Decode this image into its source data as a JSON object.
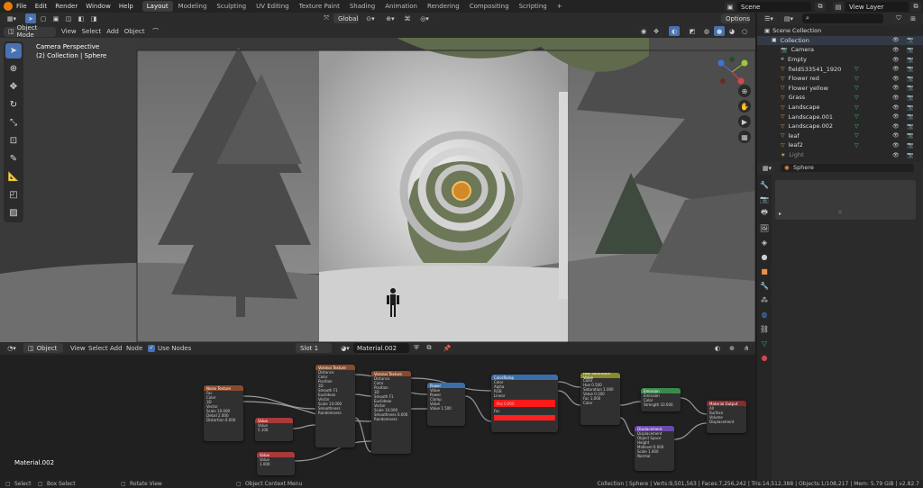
{
  "topbar": {
    "menus": [
      "File",
      "Edit",
      "Render",
      "Window",
      "Help"
    ],
    "workspaces": [
      "Layout",
      "Modeling",
      "Sculpting",
      "UV Editing",
      "Texture Paint",
      "Shading",
      "Animation",
      "Rendering",
      "Compositing",
      "Scripting"
    ],
    "active_workspace": "Layout",
    "add_tab": "+",
    "scene_label": "Scene",
    "view_layer_label": "View Layer"
  },
  "header2": {
    "transform_orientation": "Global",
    "options": "Options"
  },
  "viewport": {
    "mode": "Object Mode",
    "menus": [
      "View",
      "Select",
      "Add",
      "Object"
    ],
    "overlay_title": "Camera Perspective",
    "overlay_subtitle": "(2) Collection | Sphere"
  },
  "outliner": {
    "search_placeholder": "",
    "scene_collection": "Scene Collection",
    "items": [
      {
        "name": "Collection",
        "kind": "collection"
      },
      {
        "name": "Camera",
        "kind": "camera"
      },
      {
        "name": "Empty",
        "kind": "empty"
      },
      {
        "name": "field533541_1920",
        "kind": "mesh"
      },
      {
        "name": "Flower red",
        "kind": "mesh"
      },
      {
        "name": "Flower yellow",
        "kind": "mesh"
      },
      {
        "name": "Grass",
        "kind": "mesh"
      },
      {
        "name": "Landscape",
        "kind": "mesh"
      },
      {
        "name": "Landscape.001",
        "kind": "mesh"
      },
      {
        "name": "Landscape.002",
        "kind": "mesh"
      },
      {
        "name": "leaf",
        "kind": "mesh"
      },
      {
        "name": "leaf2",
        "kind": "mesh"
      },
      {
        "name": "Light",
        "kind": "light"
      }
    ]
  },
  "properties": {
    "object_name": "Sphere",
    "value_placeholder": "::"
  },
  "node_editor": {
    "editor_type": "Object",
    "menus": [
      "View",
      "Select",
      "Add",
      "Node"
    ],
    "use_nodes_label": "Use Nodes",
    "slot": "Slot 1",
    "material": "Material.002",
    "material_label": "Material.002"
  },
  "nodes": [
    {
      "id": "noise",
      "title": "Noise Texture",
      "rows": [
        "Fac",
        "Color",
        "3D",
        "Vector",
        "Scale 10.000",
        "Detail 2.000",
        "Distortion 0.000"
      ]
    },
    {
      "id": "voronoi1",
      "title": "Voronoi Texture",
      "rows": [
        "Distance",
        "Color",
        "Position",
        "3D",
        "Smooth F1",
        "Euclidean",
        "Vector",
        "Scale 10.000",
        "Smoothness",
        "Randomness"
      ]
    },
    {
      "id": "voronoi2",
      "title": "Voronoi Texture",
      "rows": [
        "Distance",
        "Color",
        "Position",
        "3D",
        "Smooth F1",
        "Euclidean",
        "Vector",
        "Scale 10.000",
        "Smoothness 0.000",
        "Randomness"
      ]
    },
    {
      "id": "value1",
      "title": "Value",
      "rows": [
        "Value",
        "5.100"
      ]
    },
    {
      "id": "value2",
      "title": "Value",
      "rows": [
        "Value",
        "1.000"
      ]
    },
    {
      "id": "power",
      "title": "Power",
      "rows": [
        "Value",
        "Power",
        "Clamp",
        "Value",
        "Value 1.500"
      ]
    },
    {
      "id": "colorramp",
      "title": "ColorRamp",
      "rows": [
        "Color",
        "Alpha",
        "RGB",
        "Linear",
        "Pos 0.000",
        "Fac"
      ]
    },
    {
      "id": "principled",
      "title": "Hue Saturation Value",
      "rows": [
        "Color",
        "Hue 0.500",
        "Saturation 1.000",
        "Value 0.100",
        "Fac 1.000",
        "Color"
      ]
    },
    {
      "id": "emission",
      "title": "Emission",
      "rows": [
        "Emission",
        "Color",
        "Strength 10.000"
      ]
    },
    {
      "id": "displacement",
      "title": "Displacement",
      "rows": [
        "Displacement",
        "Object Space",
        "Height",
        "Midlevel 0.000",
        "Scale 1.000",
        "Normal"
      ]
    },
    {
      "id": "output",
      "title": "Material Output",
      "rows": [
        "All",
        "Surface",
        "Volume",
        "Displacement"
      ]
    }
  ],
  "statusbar": {
    "left": [
      {
        "icon": "mouse-left-icon",
        "label": "Select"
      },
      {
        "icon": "mouse-drag-icon",
        "label": "Box Select"
      },
      {
        "icon": "mouse-middle-icon",
        "label": "Rotate View"
      },
      {
        "icon": "mouse-right-icon",
        "label": "Object Context Menu"
      }
    ],
    "stats": "Collection | Sphere | Verts:9,501,563 | Faces:7,256,242 | Tris:14,512,388 | Objects:1/108,217 | Mem: 5.79 GiB | v2.82.7"
  },
  "colors": {
    "accent": "#4772b3",
    "mesh_icon": "#e8914a",
    "light_icon": "#e0e060",
    "header_bg": "#2b2b2b",
    "panel_bg": "#303030"
  }
}
